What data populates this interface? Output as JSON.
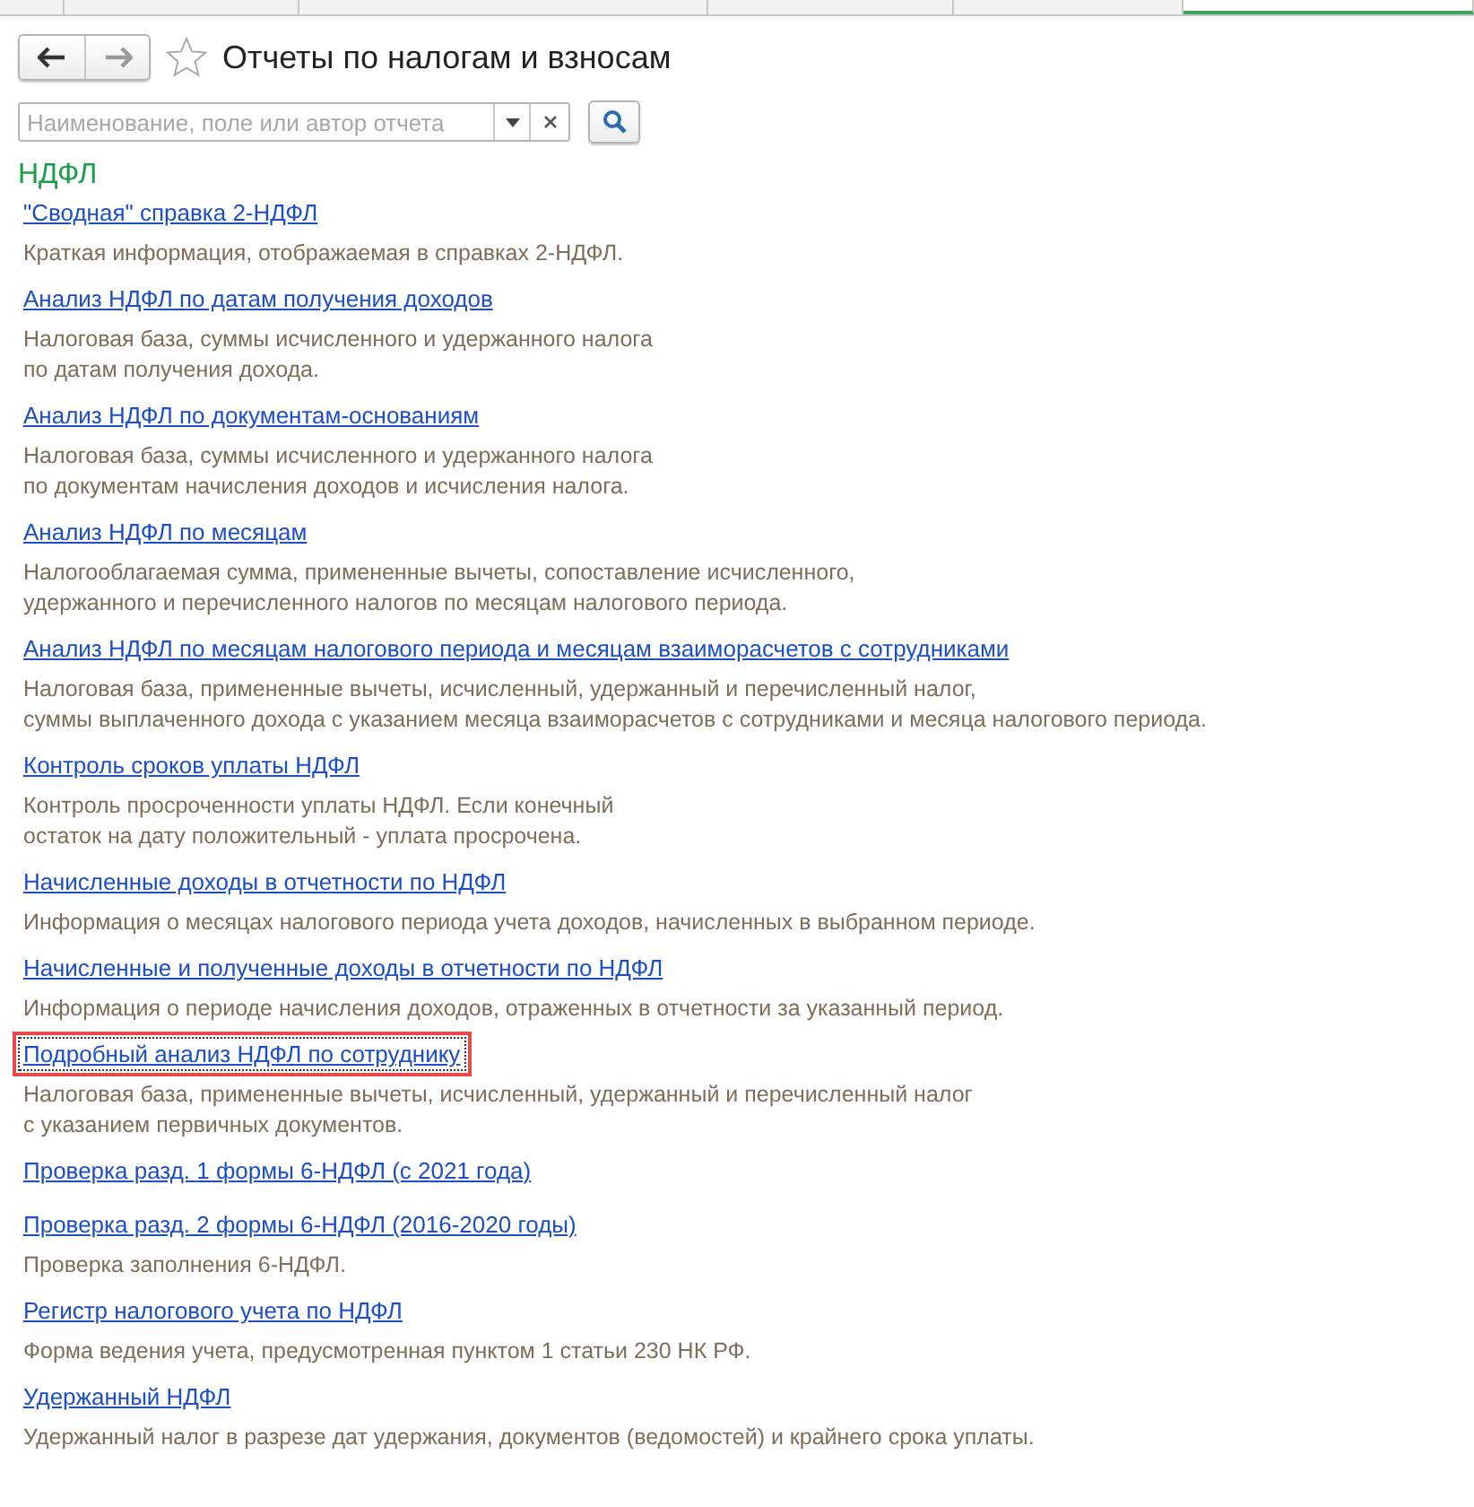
{
  "tab_strip": [
    {
      "selected": false
    },
    {
      "selected": false
    },
    {
      "selected": false
    },
    {
      "selected": false
    },
    {
      "selected": false
    },
    {
      "selected": true
    }
  ],
  "window": {
    "title": "Отчеты по налогам и взносам",
    "favorite": false
  },
  "search": {
    "placeholder": "Наименование, поле или автор отчета"
  },
  "section": {
    "title": "НДФЛ"
  },
  "reports": [
    {
      "title": "\"Сводная\" справка 2-НДФЛ",
      "description": "Краткая информация, отображаемая в справках 2-НДФЛ.",
      "focused": false
    },
    {
      "title": "Анализ НДФЛ по датам получения доходов",
      "description": "Налоговая база, суммы исчисленного и удержанного налога\nпо датам получения дохода.",
      "focused": false
    },
    {
      "title": "Анализ НДФЛ по документам-основаниям",
      "description": "Налоговая база, суммы исчисленного и удержанного налога\nпо документам начисления доходов и исчисления налога.",
      "focused": false
    },
    {
      "title": "Анализ НДФЛ по месяцам",
      "description": "Налогооблагаемая сумма, примененные вычеты, сопоставление исчисленного,\nудержанного и перечисленного налогов по месяцам налогового периода.",
      "focused": false
    },
    {
      "title": "Анализ НДФЛ по месяцам налогового периода и месяцам взаиморасчетов с сотрудниками",
      "description": "Налоговая база, примененные вычеты, исчисленный, удержанный и перечисленный налог,\nсуммы выплаченного дохода с указанием месяца взаиморасчетов с сотрудниками и месяца налогового периода.",
      "focused": false
    },
    {
      "title": "Контроль сроков уплаты НДФЛ",
      "description": "Контроль просроченности уплаты НДФЛ. Если конечный\nостаток на дату положительный - уплата просрочена.",
      "focused": false
    },
    {
      "title": "Начисленные доходы в отчетности по НДФЛ",
      "description": "Информация о месяцах налогового периода учета доходов, начисленных в выбранном периоде.",
      "focused": false
    },
    {
      "title": "Начисленные и полученные доходы в отчетности по НДФЛ",
      "description": "Информация о периоде начисления доходов, отраженных в отчетности за указанный период.",
      "focused": false
    },
    {
      "title": "Подробный анализ НДФЛ по сотруднику",
      "description": "Налоговая база, примененные вычеты, исчисленный, удержанный и перечисленный налог\nс указанием первичных документов.",
      "focused": true
    },
    {
      "title": "Проверка разд. 1 формы 6-НДФЛ (с 2021 года)",
      "focused": false
    },
    {
      "title": "Проверка разд. 2 формы 6-НДФЛ (2016-2020 годы)",
      "description": "Проверка заполнения 6-НДФЛ.",
      "focused": false
    },
    {
      "title": "Регистр налогового учета по НДФЛ",
      "description": "Форма ведения учета, предусмотренная пунктом 1 статьи 230 НК РФ.",
      "focused": false
    },
    {
      "title": "Удержанный НДФЛ",
      "description": "Удержанный налог в разрезе дат удержания, документов (ведомостей) и крайнего срока уплаты.",
      "focused": false
    }
  ]
}
